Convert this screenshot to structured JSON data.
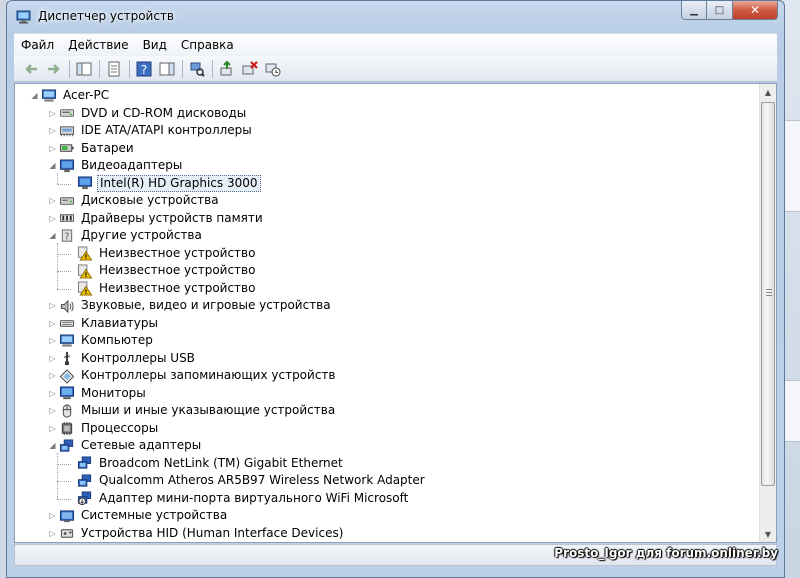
{
  "window": {
    "title": "Диспетчер устройств"
  },
  "menu": [
    "Файл",
    "Действие",
    "Вид",
    "Справка"
  ],
  "toolbar": [
    {
      "name": "back-icon",
      "disabled": true
    },
    {
      "name": "forward-icon",
      "disabled": true
    },
    {
      "sep": true
    },
    {
      "name": "console-tree-icon"
    },
    {
      "sep": true
    },
    {
      "name": "properties-icon"
    },
    {
      "sep": true
    },
    {
      "name": "help-icon"
    },
    {
      "name": "action-pane-icon"
    },
    {
      "sep": true
    },
    {
      "name": "scan-hardware-icon"
    },
    {
      "sep": true
    },
    {
      "name": "update-driver-icon"
    },
    {
      "name": "uninstall-icon"
    },
    {
      "name": "disable-device-icon"
    }
  ],
  "tree": [
    {
      "label": "Acer-PC",
      "level": 0,
      "expanded": true,
      "icon": "computer"
    },
    {
      "label": "DVD и CD-ROM дисководы",
      "level": 1,
      "icon": "dvd"
    },
    {
      "label": "IDE ATA/ATAPI контроллеры",
      "level": 1,
      "icon": "ide"
    },
    {
      "label": "Батареи",
      "level": 1,
      "icon": "battery"
    },
    {
      "label": "Видеоадаптеры",
      "level": 1,
      "expanded": true,
      "icon": "display"
    },
    {
      "label": "Intel(R) HD Graphics 3000",
      "level": 2,
      "icon": "display",
      "selected": true
    },
    {
      "label": "Дисковые устройства",
      "level": 1,
      "icon": "disk"
    },
    {
      "label": "Драйверы устройств памяти",
      "level": 1,
      "icon": "memory"
    },
    {
      "label": "Другие устройства",
      "level": 1,
      "expanded": true,
      "icon": "unknown"
    },
    {
      "label": "Неизвестное устройство",
      "level": 2,
      "icon": "warning"
    },
    {
      "label": "Неизвестное устройство",
      "level": 2,
      "icon": "warning"
    },
    {
      "label": "Неизвестное устройство",
      "level": 2,
      "icon": "warning"
    },
    {
      "label": "Звуковые, видео и игровые устройства",
      "level": 1,
      "icon": "sound"
    },
    {
      "label": "Клавиатуры",
      "level": 1,
      "icon": "keyboard"
    },
    {
      "label": "Компьютер",
      "level": 1,
      "icon": "computer"
    },
    {
      "label": "Контроллеры USB",
      "level": 1,
      "icon": "usb"
    },
    {
      "label": "Контроллеры запоминающих устройств",
      "level": 1,
      "icon": "storage"
    },
    {
      "label": "Мониторы",
      "level": 1,
      "icon": "monitor"
    },
    {
      "label": "Мыши и иные указывающие устройства",
      "level": 1,
      "icon": "mouse"
    },
    {
      "label": "Процессоры",
      "level": 1,
      "icon": "cpu"
    },
    {
      "label": "Сетевые адаптеры",
      "level": 1,
      "expanded": true,
      "icon": "network"
    },
    {
      "label": "Broadcom NetLink (TM) Gigabit Ethernet",
      "level": 2,
      "icon": "network"
    },
    {
      "label": "Qualcomm Atheros AR5B97 Wireless Network Adapter",
      "level": 2,
      "icon": "network"
    },
    {
      "label": "Адаптер мини-порта виртуального WiFi Microsoft",
      "level": 2,
      "icon": "network-down"
    },
    {
      "label": "Системные устройства",
      "level": 1,
      "icon": "system"
    },
    {
      "label": "Устройства HID (Human Interface Devices)",
      "level": 1,
      "icon": "hid"
    }
  ],
  "colors": {
    "selection_bg": "#e6eef8",
    "warning": "#f2c200",
    "monitor_blue": "#2f5fb8"
  },
  "watermark": "Prosto_Igor для forum.onliner.by"
}
